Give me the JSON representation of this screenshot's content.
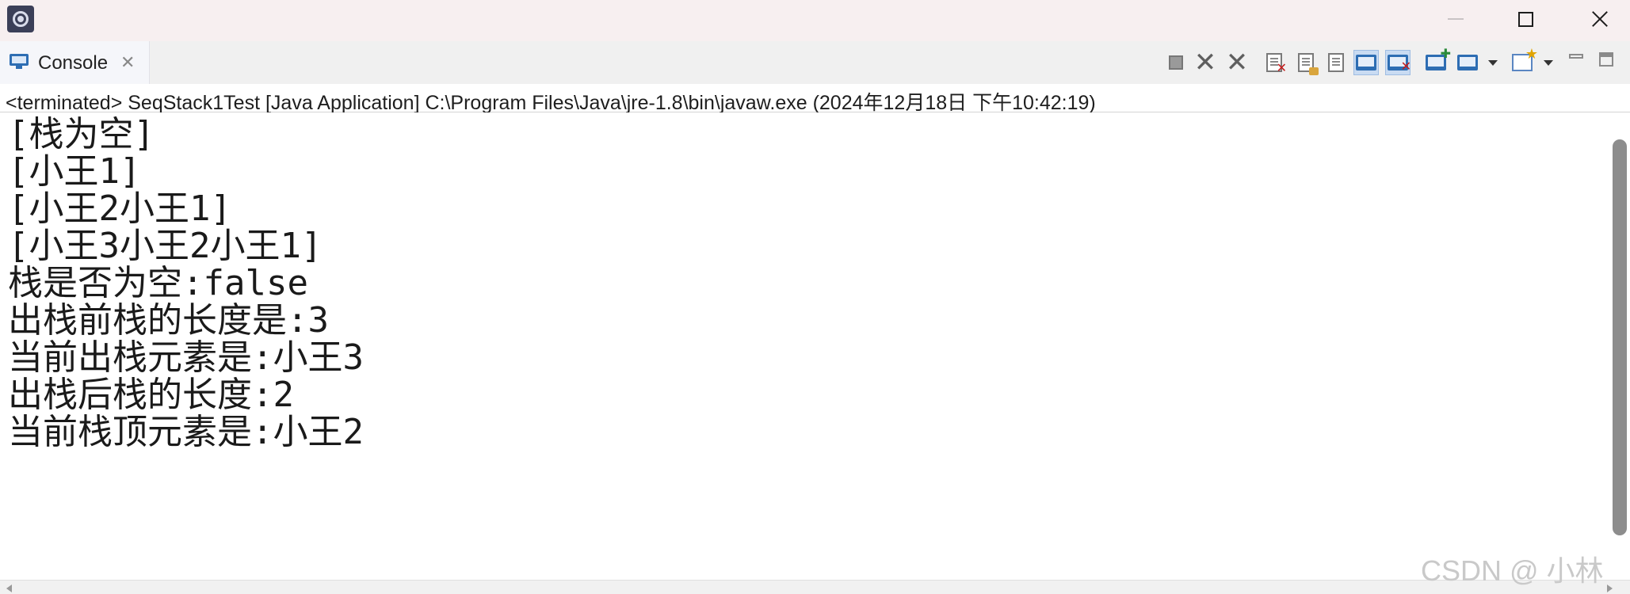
{
  "window": {
    "icon": "eclipse-app-icon"
  },
  "tab": {
    "label": "Console",
    "close_glyph": "✕",
    "icon": "console-icon"
  },
  "toolbar": {
    "icons": [
      "terminate-icon",
      "remove-launch-icon",
      "remove-all-terminated-icon",
      "clear-console-icon",
      "scroll-lock-icon",
      "word-wrap-icon",
      "show-on-stdout-icon",
      "show-on-stderr-icon",
      "pin-console-icon",
      "display-selected-console-icon",
      "open-console-icon",
      "minimize-view-icon",
      "maximize-view-icon"
    ]
  },
  "status": {
    "text": "<terminated> SeqStack1Test [Java Application] C:\\Program Files\\Java\\jre-1.8\\bin\\javaw.exe  (2024年12月18日 下午10:42:19)"
  },
  "output": {
    "lines": [
      "[栈为空]",
      "[小王1]",
      "[小王2小王1]",
      "[小王3小王2小王1]",
      "栈是否为空:false",
      "出栈前栈的长度是:3",
      "当前出栈元素是:小王3",
      "出栈后栈的长度:2",
      "当前栈顶元素是:小王2"
    ]
  },
  "watermark": {
    "text": "CSDN @ 小林"
  }
}
